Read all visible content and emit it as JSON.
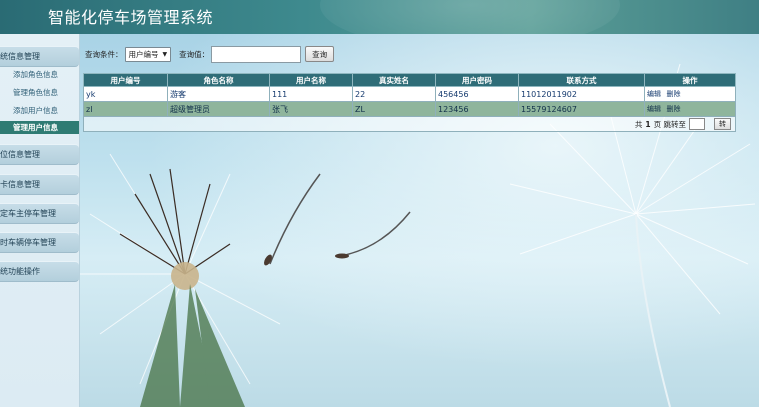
{
  "app": {
    "title": "智能化停车场管理系统"
  },
  "sidebar": {
    "groups": [
      {
        "label": "统信息管理"
      },
      {
        "label": "位信息管理"
      },
      {
        "label": "卡信息管理"
      },
      {
        "label": "定车主停车管理"
      },
      {
        "label": "时车辆停车管理"
      },
      {
        "label": "统功能操作"
      }
    ],
    "sub_items": [
      {
        "label": "添加角色信息"
      },
      {
        "label": "管理角色信息"
      },
      {
        "label": "添加用户信息"
      },
      {
        "label": "管理用户信息",
        "active": true
      }
    ]
  },
  "search": {
    "condition_label": "查询条件：",
    "condition_value": "用户编号",
    "value_label": "查询值：",
    "value_input": "",
    "button": "查询"
  },
  "table": {
    "headers": [
      "用户编号",
      "角色名称",
      "用户名称",
      "真实姓名",
      "用户密码",
      "联系方式",
      "操作"
    ],
    "rows": [
      [
        "yk",
        "游客",
        "111",
        "22",
        "456456",
        "11012011902"
      ],
      [
        "zl",
        "超级管理员",
        "张飞",
        "ZL",
        "123456",
        "15579124607"
      ]
    ],
    "edit_label": "编辑",
    "delete_label": "删除"
  },
  "pager": {
    "prefix": "共",
    "pages": "1",
    "suffix": "页 跳转至",
    "jump_button": "转"
  },
  "colors": {
    "header": "#3e8a8e",
    "table_header": "#2f6d78",
    "active_nav": "#2f7b73",
    "selected_row": "#8fb59c"
  }
}
